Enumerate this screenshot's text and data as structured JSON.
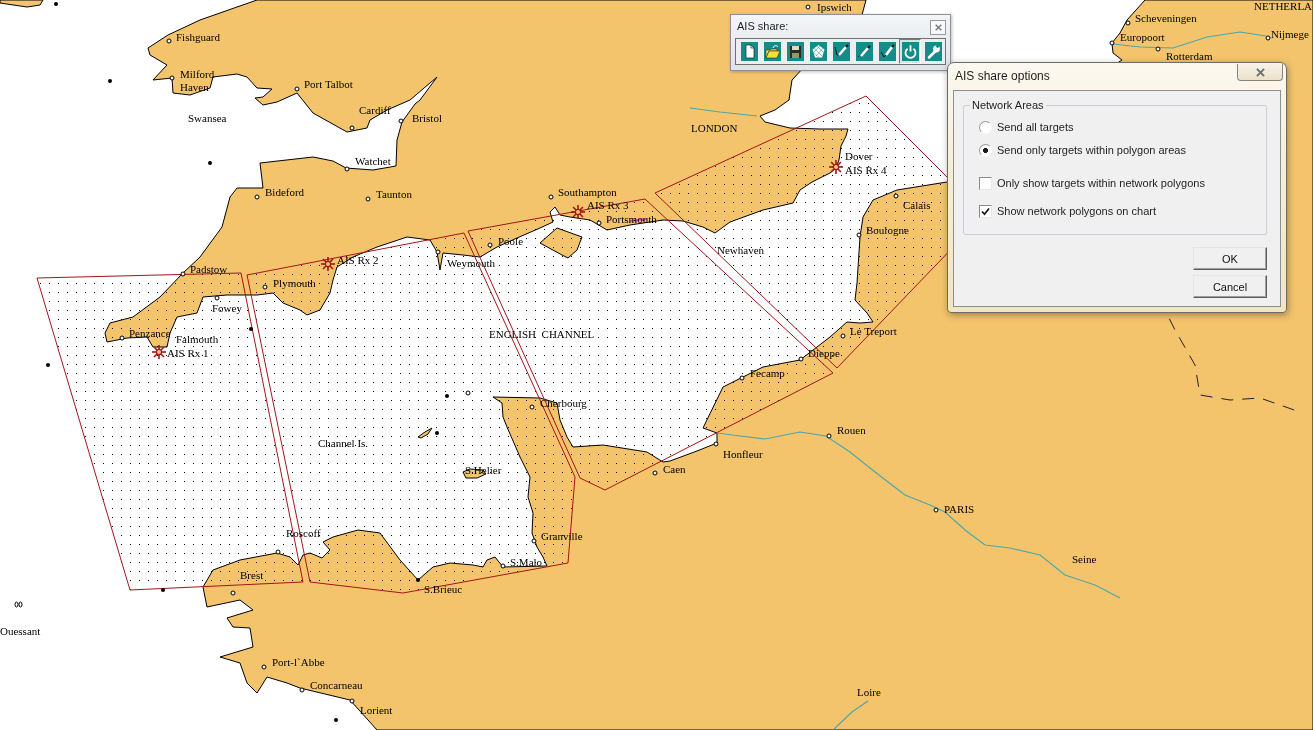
{
  "map": {
    "place_labels": [
      "Ipswich",
      "NETHERLA",
      "Scheveningen",
      "Fishguard",
      "Europoort",
      "Nijmege",
      "Rotterdam",
      "Milford Haven",
      "Port Talbot",
      "Swansea",
      "Cardiff",
      "Bristol",
      "LONDON",
      "Watchet",
      "Dover",
      "Bideford",
      "Taunton",
      "Southampton",
      "Calais",
      "Portsmouth",
      "Boulogne",
      "Poole",
      "Newhaven",
      "Padstow",
      "Weymouth",
      "Plymouth",
      "Fowey",
      "Penzance",
      "Falmouth",
      "ENGLISH  CHANNEL",
      "Le Treport",
      "Dieppe",
      "Fecamp",
      "Cherbourg",
      "Rouen",
      "Channel Is.",
      "Honfleur",
      "S.Helier",
      "Caen",
      "PARIS",
      "Roscoff",
      "Granville",
      "S.Malo",
      "Seine",
      "Brest",
      "S.Brieuc",
      "Ouessant",
      "Port-l`Abbe",
      "Concarneau",
      "Loire",
      "Lorient"
    ],
    "receivers": [
      "AIS Rx 1",
      "AIS Rx 2",
      "AIS Rx 3",
      "AIS Rx 4"
    ]
  },
  "toolbar": {
    "title": "AIS share:",
    "buttons": [
      {
        "kind": "new",
        "pressed": false
      },
      {
        "kind": "open",
        "pressed": false
      },
      {
        "kind": "save",
        "pressed": false
      },
      {
        "kind": "polygon",
        "pressed": false
      },
      {
        "kind": "edit",
        "pressed": false
      },
      {
        "kind": "edit_points",
        "pressed": false
      },
      {
        "kind": "accept",
        "pressed": false
      },
      {
        "kind": "power",
        "pressed": true
      },
      {
        "kind": "settings",
        "pressed": false
      }
    ]
  },
  "dialog": {
    "title": "AIS share options",
    "group_title": "Network Areas",
    "options": [
      {
        "kind": "radio",
        "label": "Send all targets",
        "selected": false
      },
      {
        "kind": "radio",
        "label": "Send only targets within polygon areas",
        "selected": true
      },
      {
        "kind": "checkbox",
        "label": "Only show targets within network polygons",
        "checked": false
      },
      {
        "kind": "checkbox",
        "label": "Show network polygons on chart",
        "checked": true
      }
    ],
    "buttons": [
      "OK",
      "Cancel"
    ]
  }
}
